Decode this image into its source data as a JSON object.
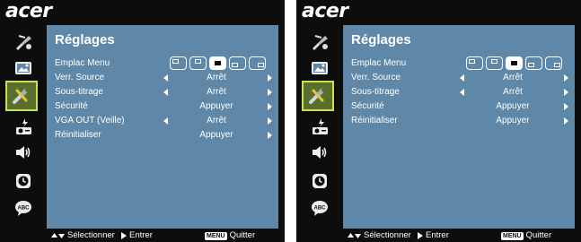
{
  "brand": "acer",
  "colors": {
    "panel": "#5e87a8",
    "background": "#0d0d0d",
    "selected_border": "#c8e05a"
  },
  "sidebar_items": [
    "brush-icon",
    "picture-icon",
    "wrench-icon",
    "projector-icon",
    "speaker-icon",
    "clock-icon",
    "abc-icon"
  ],
  "footer": {
    "select_label": "Sélectionner",
    "enter_label": "Entrer",
    "menu_key": "MENU",
    "quit_label": "Quitter"
  },
  "screens": [
    {
      "title": "Réglages",
      "rows": [
        {
          "label": "Emplac Menu",
          "type": "positions",
          "selected_index": 2
        },
        {
          "label": "Verr. Source",
          "type": "toggle",
          "value": "Arrêt"
        },
        {
          "label": "Sous-titrage",
          "type": "toggle",
          "value": "Arrêt"
        },
        {
          "label": "Sécurité",
          "type": "action",
          "value": "Appuyer"
        },
        {
          "label": "VGA OUT (Veille)",
          "type": "toggle",
          "value": "Arrêt"
        },
        {
          "label": "Réinitialiser",
          "type": "action",
          "value": "Appuyer"
        }
      ]
    },
    {
      "title": "Réglages",
      "rows": [
        {
          "label": "Emplac Menu",
          "type": "positions",
          "selected_index": 2
        },
        {
          "label": "Verr. Source",
          "type": "toggle",
          "value": "Arrêt"
        },
        {
          "label": "Sous-titrage",
          "type": "toggle",
          "value": "Arrêt"
        },
        {
          "label": "Sécurité",
          "type": "action",
          "value": "Appuyer"
        },
        {
          "label": "Réinitialiser",
          "type": "action",
          "value": "Appuyer"
        }
      ]
    }
  ]
}
